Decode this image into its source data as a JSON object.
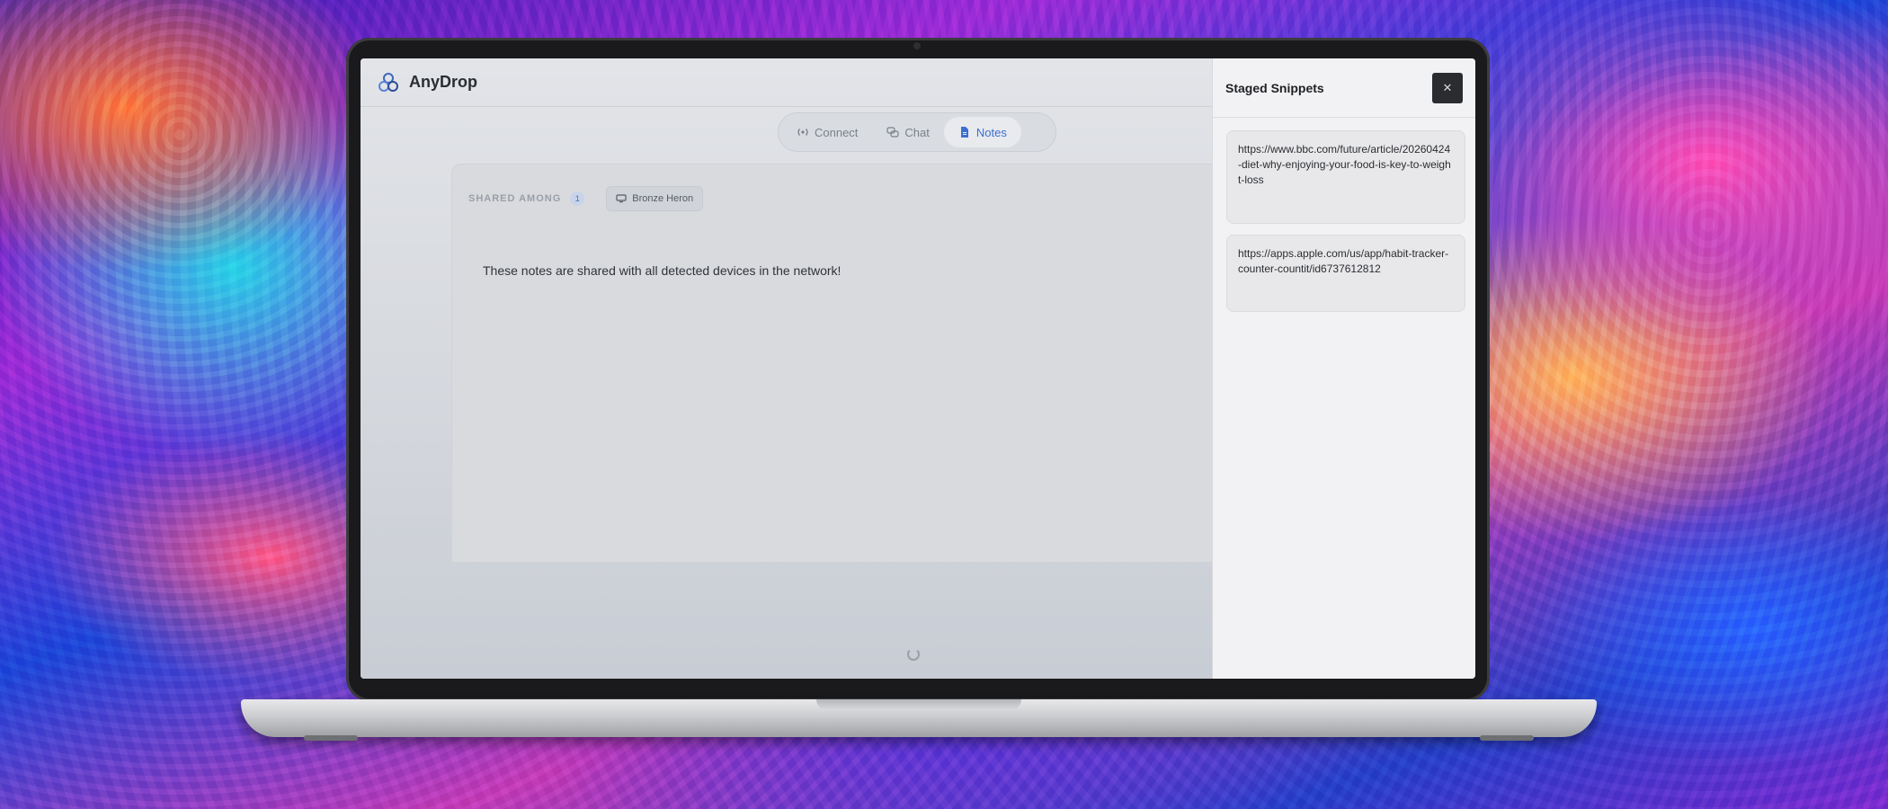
{
  "app": {
    "title": "AnyDrop",
    "tabs": [
      {
        "label": "Connect",
        "icon": "broadcast-icon",
        "active": false
      },
      {
        "label": "Chat",
        "icon": "chat-bubbles-icon",
        "active": false
      },
      {
        "label": "Notes",
        "icon": "document-icon",
        "active": true
      }
    ],
    "accent_color": "#3b6fd1"
  },
  "notes": {
    "shared_label": "SHARED AMONG",
    "shared_count": "1",
    "device_name": "Bronze Heron",
    "body_text": "These notes are shared with all detected devices in the network!"
  },
  "drawer": {
    "title": "Staged Snippets",
    "close_label": "✕",
    "snippets": [
      {
        "text": "https://www.bbc.com/future/article/20260424-diet-why-enjoying-your-food-is-key-to-weight-loss"
      },
      {
        "text": "https://apps.apple.com/us/app/habit-tracker-counter-countit/id6737612812"
      }
    ]
  }
}
